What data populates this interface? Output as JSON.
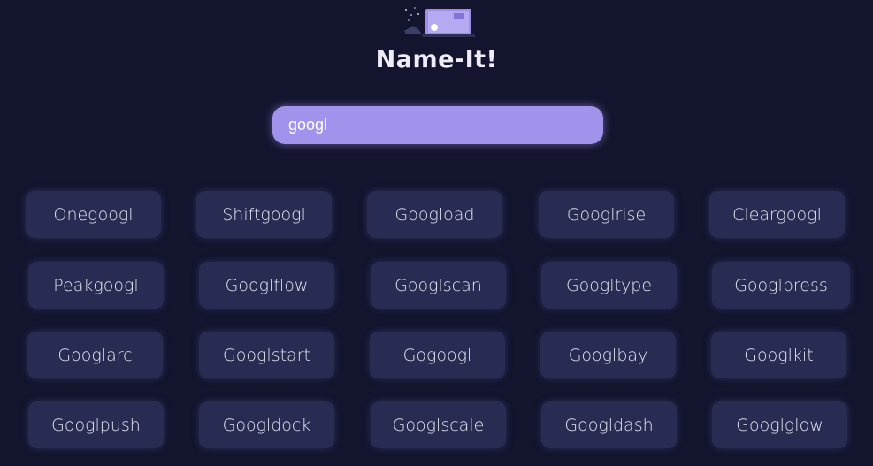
{
  "app": {
    "title": "Name-It!"
  },
  "search": {
    "value": "googl"
  },
  "colors": {
    "background": "#13152e",
    "card": "#282c52",
    "accent": "#a193ec"
  },
  "names": [
    [
      "Onegoogl",
      "Shiftgoogl",
      "Goog­load",
      "Googlrise",
      "Cleargoogl"
    ],
    [
      "Peakgoogl",
      "Googlflow",
      "Googlscan",
      "Googltype",
      "Googlpress"
    ],
    [
      "Googlarc",
      "Googlstart",
      "Gogoogl",
      "Googlbay",
      "Googlkit"
    ],
    [
      "Googlpush",
      "Googldock",
      "Googlscale",
      "Googldash",
      "Googlglow"
    ]
  ]
}
